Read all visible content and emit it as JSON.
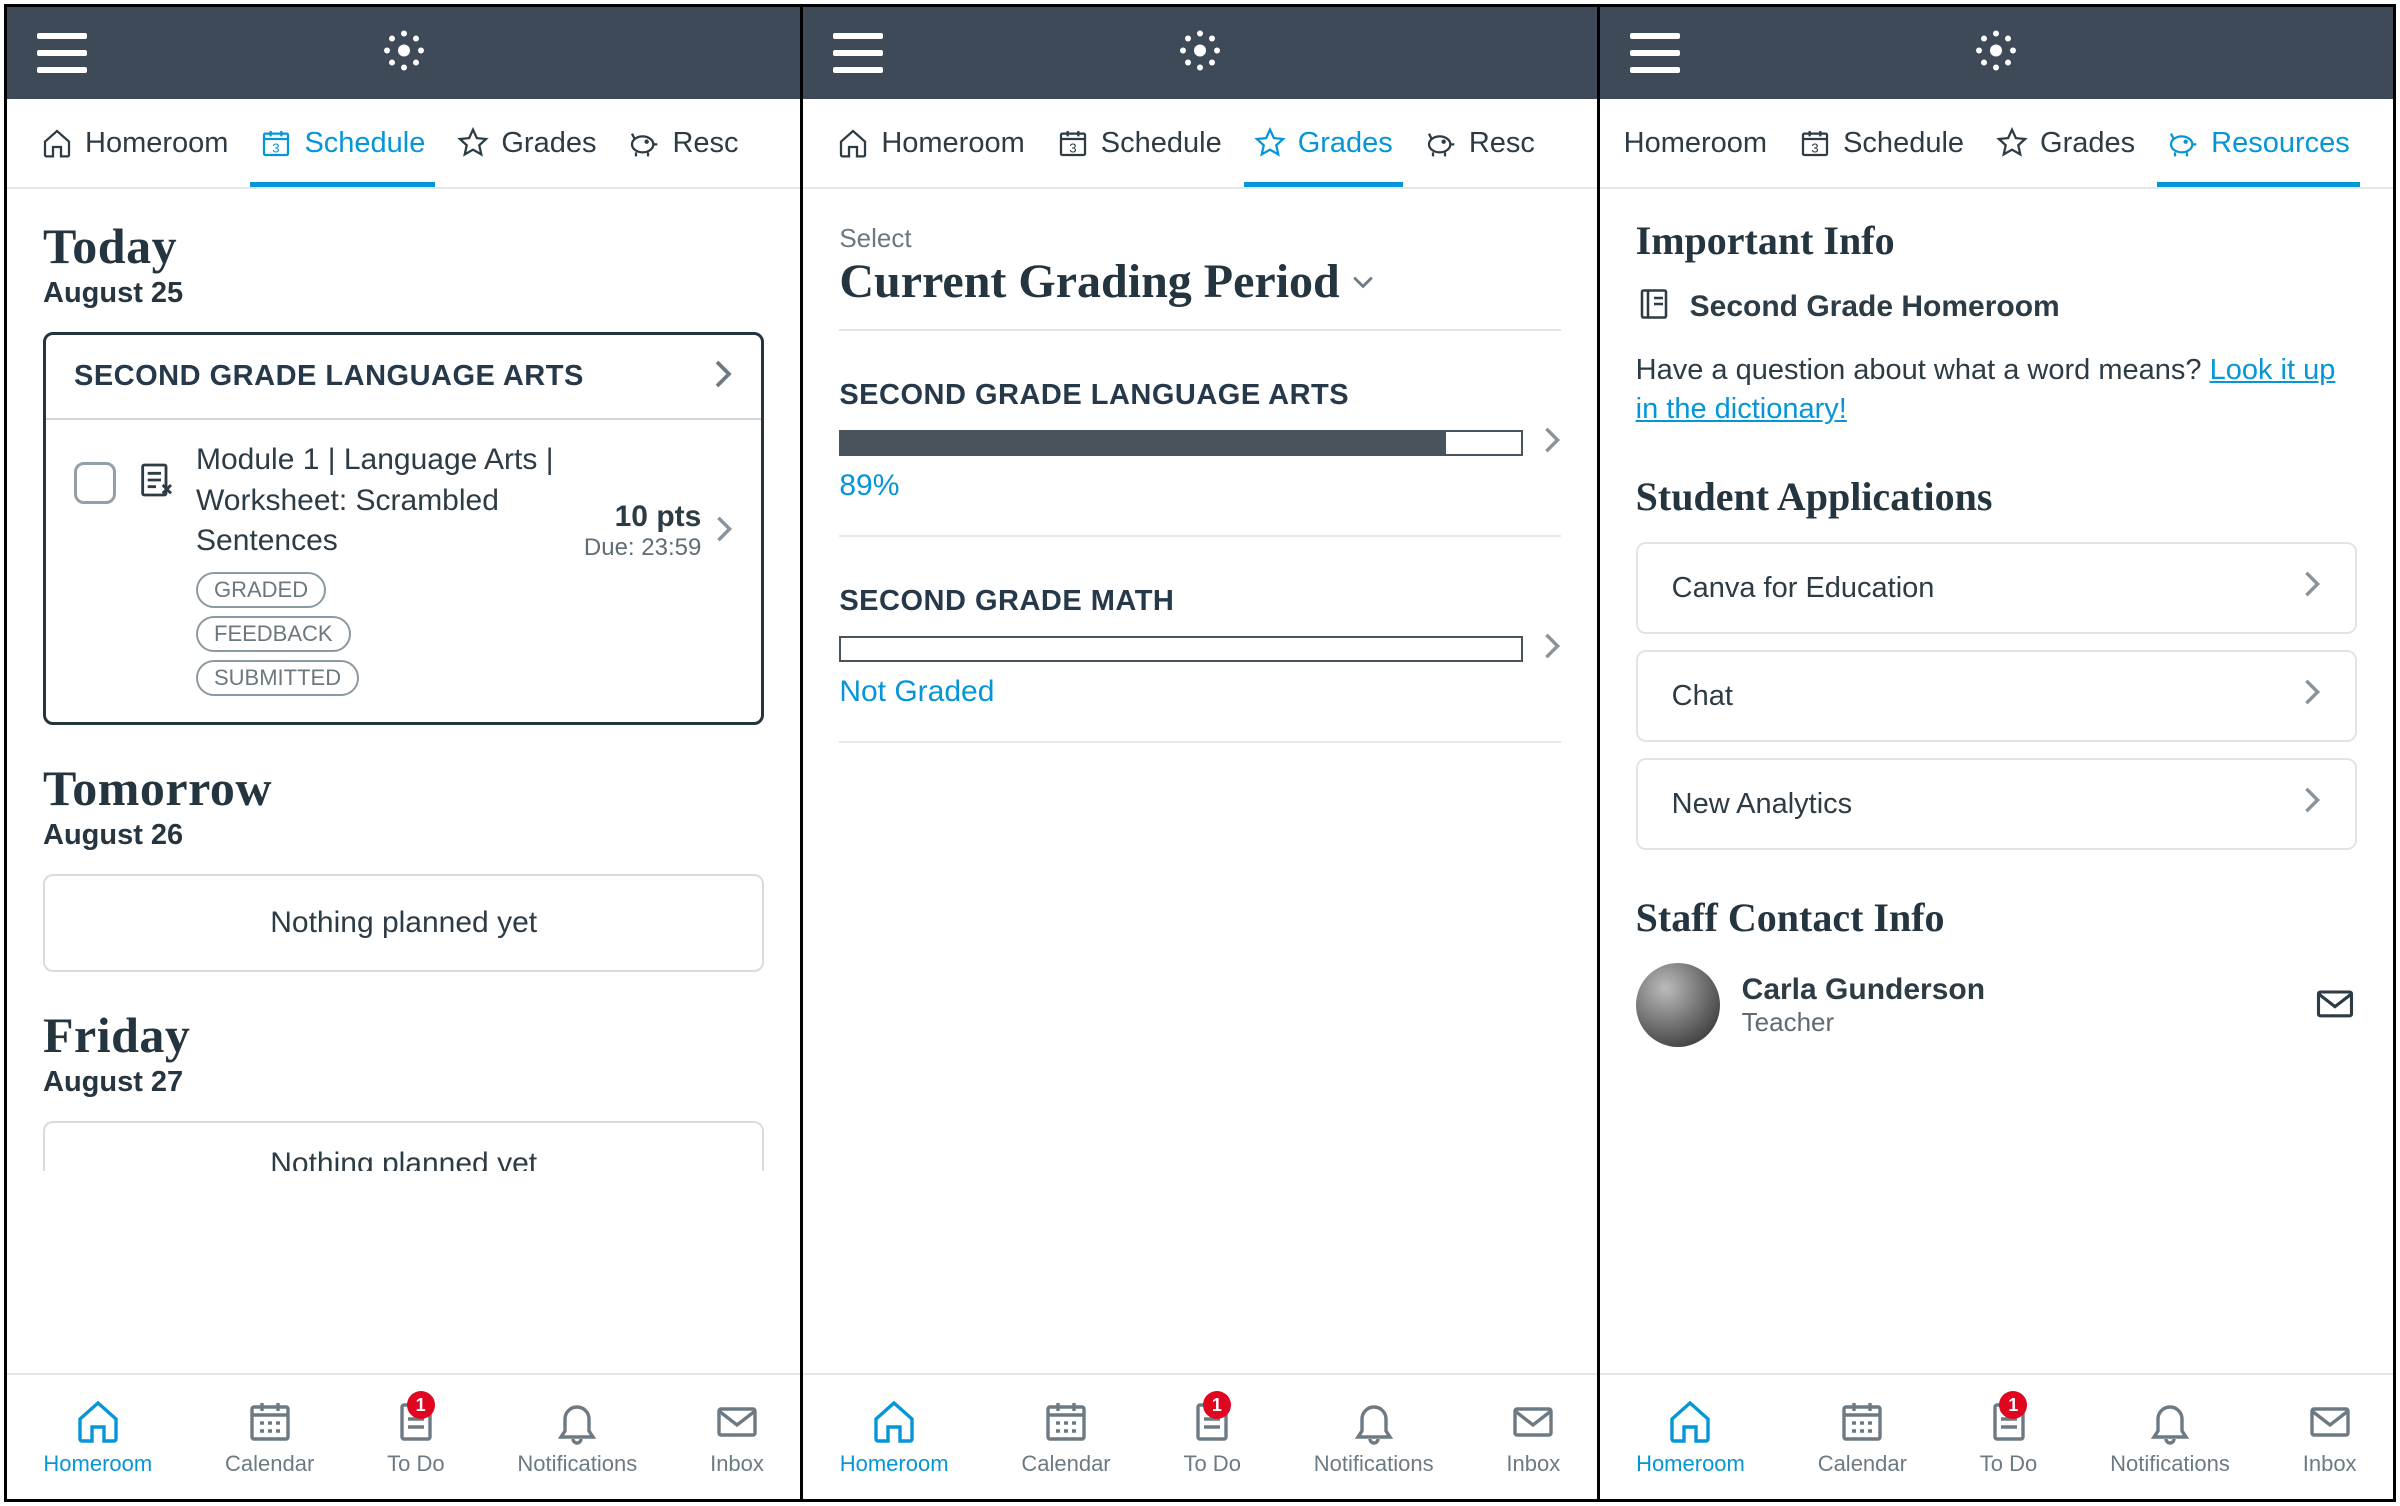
{
  "tabs": {
    "homeroom": "Homeroom",
    "schedule": "Schedule",
    "grades": "Grades",
    "resources": "Resources",
    "resources_cut": "Resc"
  },
  "bottom": {
    "homeroom": "Homeroom",
    "calendar": "Calendar",
    "todo": "To Do",
    "notifications": "Notifications",
    "inbox": "Inbox",
    "badge": "1"
  },
  "schedule": {
    "today_label": "Today",
    "today_date": "August 25",
    "course_title": "SECOND GRADE LANGUAGE ARTS",
    "assignment_title": "Module 1 | Language Arts | Worksheet: Scrambled Sentences",
    "tags": [
      "GRADED",
      "FEEDBACK",
      "SUBMITTED"
    ],
    "points": "10 pts",
    "due": "Due: 23:59",
    "tomorrow_label": "Tomorrow",
    "tomorrow_date": "August 26",
    "empty": "Nothing planned yet",
    "friday_label": "Friday",
    "friday_date": "August 27",
    "cut_text": "Nothing planned yet"
  },
  "grades": {
    "select_label": "Select",
    "select_value": "Current Grading Period",
    "course1": "SECOND GRADE LANGUAGE ARTS",
    "course1_pct": 89,
    "course1_score": "89%",
    "course2": "SECOND GRADE MATH",
    "course2_score": "Not Graded"
  },
  "resources": {
    "info_head": "Important Info",
    "info_course": "Second Grade Homeroom",
    "info_text_pre": "Have a question about what a word means? ",
    "info_link": "Look it up in the dictionary!",
    "apps_head": "Student Applications",
    "apps": [
      "Canva for Education",
      "Chat",
      "New Analytics"
    ],
    "staff_head": "Staff Contact Info",
    "staff_name": "Carla Gunderson",
    "staff_role": "Teacher"
  }
}
